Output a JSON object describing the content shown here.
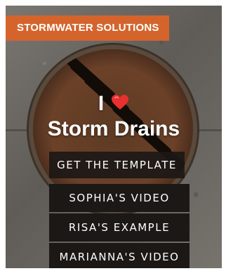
{
  "banner": {
    "title": "STORMWATER SOLUTIONS",
    "color": "#d5642c"
  },
  "headline": {
    "line1_text": "I",
    "line1_icon": "heart-icon",
    "line2_text": "Storm Drains"
  },
  "buttons": [
    {
      "label": "GET THE TEMPLATE"
    },
    {
      "label": "SOPHIA'S VIDEO"
    },
    {
      "label": "RISA'S EXAMPLE"
    },
    {
      "label": "MARIANNA'S VIDEO"
    }
  ],
  "colors": {
    "heart": "#e8302f",
    "button_bg": "#1b1816"
  }
}
